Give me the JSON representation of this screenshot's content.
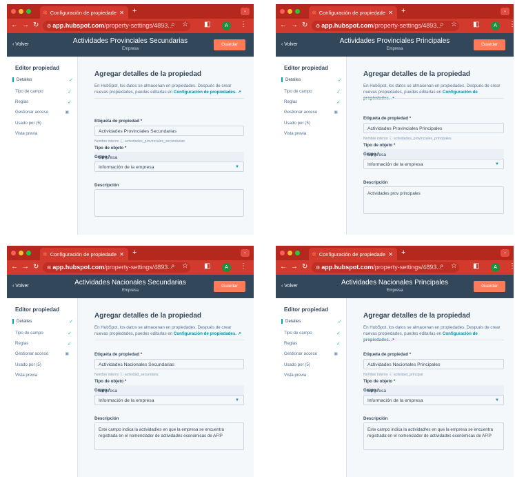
{
  "browser": {
    "tab_title": "Configuración de propiedade",
    "new_tab": "+",
    "url_host": "app.hubspot.com",
    "url_path": "/property-settings/4893...",
    "avatar_letter": "A"
  },
  "colors": {
    "chrome_red": "#b5281e",
    "hubspot_navy": "#33475b",
    "guardar_orange": "#ff7a59",
    "active_teal": "#00a4bd"
  },
  "ui": {
    "volver": "Volver",
    "guardar": "Guardar",
    "editor_heading": "Editor propiedad",
    "sidebar": [
      "Detalles",
      "Tipo de campo",
      "Reglas",
      "Gestionar acceso",
      "Usado por (5)",
      "Vista previa"
    ],
    "section_title": "Agregar detalles de la propiedad",
    "section_desc": "En HubSpot, los datos se almacenan en propiedades. Después de crear nuevas propiedades, puedes editarlas en",
    "section_desc_link": "Configuración de propiedades.",
    "label_etiqueta": "Etiqueta de propiedad *",
    "internal_label": "Nombre interno",
    "label_tipo": "Tipo de objeto *",
    "tipo_value": "Empresa",
    "label_grupo": "Grupo *",
    "grupo_value": "Información de la empresa",
    "label_descripcion": "Descripción"
  },
  "panels": [
    {
      "header_title": "Actividades Provinciales Secundarias",
      "header_subtitle": "Empresa",
      "etiqueta": "Actividades Provinciales Secundarias",
      "internal_name": "actividades_provinciales_secundarias",
      "descripcion": ""
    },
    {
      "header_title": "Actividades Provinciales Principales",
      "header_subtitle": "Empresa",
      "etiqueta": "Actividades Provinciales Principales",
      "internal_name": "actividades_provinciales_principales",
      "descripcion": "Actividades prov principales"
    },
    {
      "header_title": "Actividades Nacionales Secundarias",
      "header_subtitle": "Empresa",
      "etiqueta": "Actividades Nacionales Secundarias",
      "internal_name": "actividad_secundaria",
      "descripcion": "Este campo indica la actividad/es en que la empresa se encuentra registrada en el nomenclador de actividades económicas de AFIP"
    },
    {
      "header_title": "Actividades Nacionales Principales",
      "header_subtitle": "Empresa",
      "etiqueta": "Actividades Nacionales Principales",
      "internal_name": "actividad_principal",
      "descripcion": "Este campo indica la actividad/es en que la empresa se encuentra registrada en el nomenclador de actividades económicas de AFIP"
    }
  ]
}
